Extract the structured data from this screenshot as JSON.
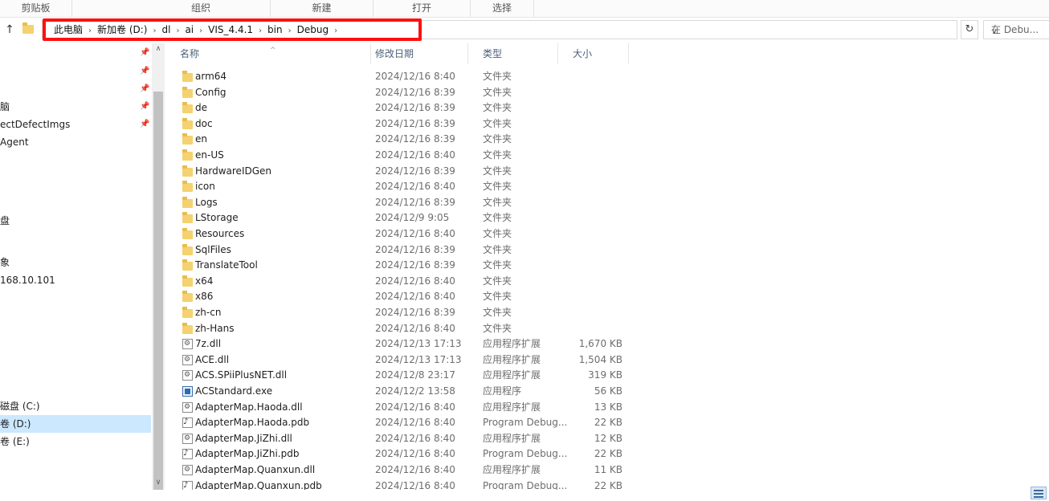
{
  "ribbon": {
    "groups": [
      "剪贴板",
      "组织",
      "新建",
      "打开",
      "选择"
    ]
  },
  "address": {
    "segments": [
      "此电脑",
      "新加卷 (D:)",
      "dl",
      "ai",
      "VIS_4.4.1",
      "bin",
      "Debug"
    ],
    "search_placeholder": "在 Debu..."
  },
  "navpane": {
    "items": [
      {
        "label": "",
        "pinned": true
      },
      {
        "label": "",
        "pinned": true
      },
      {
        "label": "",
        "pinned": true
      },
      {
        "label": "脑",
        "pinned": true
      },
      {
        "label": "ectDefectImgs",
        "pinned": true
      },
      {
        "label": "Agent",
        "pinned": false
      },
      {
        "label": "",
        "pinned": false
      },
      {
        "label": "",
        "pinned": false
      },
      {
        "label": "盘",
        "pinned": false
      },
      {
        "label": "",
        "pinned": false
      },
      {
        "label": "象",
        "pinned": false
      },
      {
        "label": "168.10.101",
        "pinned": false
      },
      {
        "label": "",
        "pinned": false
      },
      {
        "label": "",
        "pinned": false
      },
      {
        "label": "",
        "pinned": false
      },
      {
        "label": "",
        "pinned": false
      },
      {
        "label": "磁盘 (C:)",
        "pinned": false
      },
      {
        "label": "卷 (D:)",
        "pinned": false,
        "selected": true
      },
      {
        "label": "卷 (E:)",
        "pinned": false
      }
    ]
  },
  "list": {
    "columns": [
      "名称",
      "修改日期",
      "类型",
      "大小"
    ],
    "rows": [
      {
        "icon": "folder",
        "name": "arm64",
        "date": "2024/12/16 8:40",
        "type": "文件夹",
        "size": ""
      },
      {
        "icon": "folder",
        "name": "Config",
        "date": "2024/12/16 8:39",
        "type": "文件夹",
        "size": ""
      },
      {
        "icon": "folder",
        "name": "de",
        "date": "2024/12/16 8:39",
        "type": "文件夹",
        "size": ""
      },
      {
        "icon": "folder",
        "name": "doc",
        "date": "2024/12/16 8:39",
        "type": "文件夹",
        "size": ""
      },
      {
        "icon": "folder",
        "name": "en",
        "date": "2024/12/16 8:39",
        "type": "文件夹",
        "size": ""
      },
      {
        "icon": "folder",
        "name": "en-US",
        "date": "2024/12/16 8:40",
        "type": "文件夹",
        "size": ""
      },
      {
        "icon": "folder",
        "name": "HardwareIDGen",
        "date": "2024/12/16 8:39",
        "type": "文件夹",
        "size": ""
      },
      {
        "icon": "folder",
        "name": "icon",
        "date": "2024/12/16 8:40",
        "type": "文件夹",
        "size": ""
      },
      {
        "icon": "folder",
        "name": "Logs",
        "date": "2024/12/16 8:39",
        "type": "文件夹",
        "size": ""
      },
      {
        "icon": "folder",
        "name": "LStorage",
        "date": "2024/12/9 9:05",
        "type": "文件夹",
        "size": ""
      },
      {
        "icon": "folder",
        "name": "Resources",
        "date": "2024/12/16 8:40",
        "type": "文件夹",
        "size": ""
      },
      {
        "icon": "folder",
        "name": "SqlFiles",
        "date": "2024/12/16 8:39",
        "type": "文件夹",
        "size": ""
      },
      {
        "icon": "folder",
        "name": "TranslateTool",
        "date": "2024/12/16 8:39",
        "type": "文件夹",
        "size": ""
      },
      {
        "icon": "folder",
        "name": "x64",
        "date": "2024/12/16 8:40",
        "type": "文件夹",
        "size": ""
      },
      {
        "icon": "folder",
        "name": "x86",
        "date": "2024/12/16 8:40",
        "type": "文件夹",
        "size": ""
      },
      {
        "icon": "folder",
        "name": "zh-cn",
        "date": "2024/12/16 8:39",
        "type": "文件夹",
        "size": ""
      },
      {
        "icon": "folder",
        "name": "zh-Hans",
        "date": "2024/12/16 8:40",
        "type": "文件夹",
        "size": ""
      },
      {
        "icon": "dll",
        "name": "7z.dll",
        "date": "2024/12/13 17:13",
        "type": "应用程序扩展",
        "size": "1,670 KB"
      },
      {
        "icon": "dll",
        "name": "ACE.dll",
        "date": "2024/12/13 17:13",
        "type": "应用程序扩展",
        "size": "1,504 KB"
      },
      {
        "icon": "dll",
        "name": "ACS.SPiiPlusNET.dll",
        "date": "2024/12/8 23:17",
        "type": "应用程序扩展",
        "size": "319 KB"
      },
      {
        "icon": "exe",
        "name": "ACStandard.exe",
        "date": "2024/12/2 13:58",
        "type": "应用程序",
        "size": "56 KB"
      },
      {
        "icon": "dll",
        "name": "AdapterMap.Haoda.dll",
        "date": "2024/12/16 8:40",
        "type": "应用程序扩展",
        "size": "13 KB"
      },
      {
        "icon": "pdb",
        "name": "AdapterMap.Haoda.pdb",
        "date": "2024/12/16 8:40",
        "type": "Program Debug...",
        "size": "22 KB"
      },
      {
        "icon": "dll",
        "name": "AdapterMap.JiZhi.dll",
        "date": "2024/12/16 8:40",
        "type": "应用程序扩展",
        "size": "12 KB"
      },
      {
        "icon": "pdb",
        "name": "AdapterMap.JiZhi.pdb",
        "date": "2024/12/16 8:40",
        "type": "Program Debug...",
        "size": "22 KB"
      },
      {
        "icon": "dll",
        "name": "AdapterMap.Quanxun.dll",
        "date": "2024/12/16 8:40",
        "type": "应用程序扩展",
        "size": "11 KB"
      },
      {
        "icon": "pdb",
        "name": "AdapterMap.Quanxun.pdb",
        "date": "2024/12/16 8:40",
        "type": "Program Debug...",
        "size": "22 KB"
      }
    ]
  }
}
